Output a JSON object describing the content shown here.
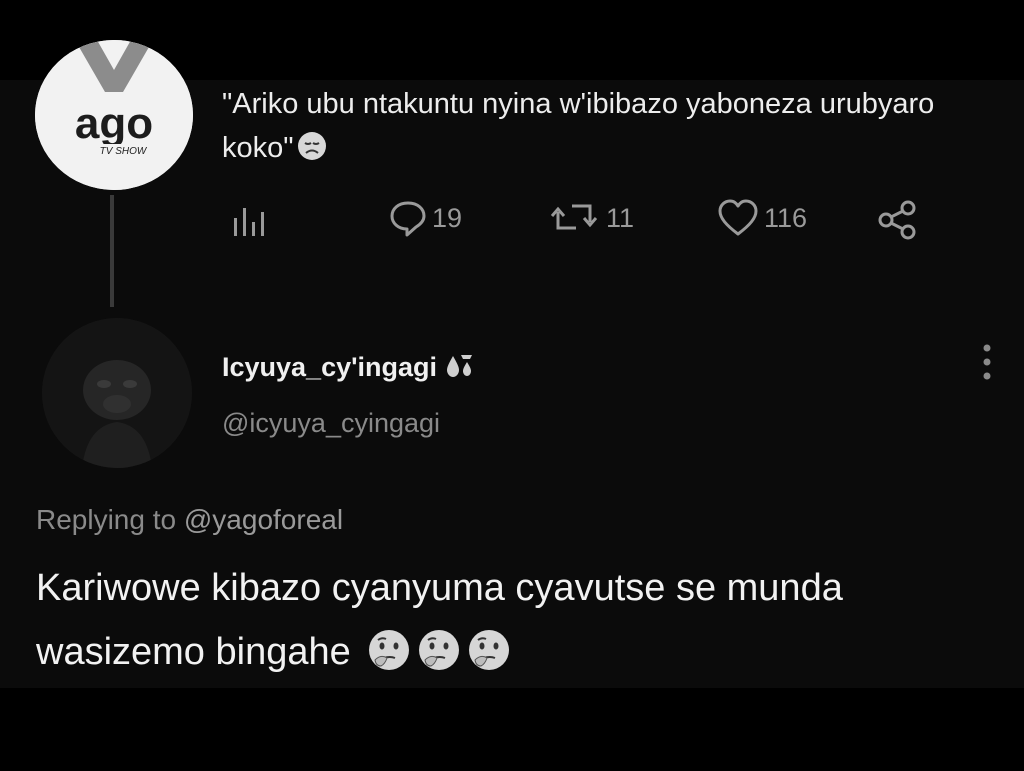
{
  "parent_tweet": {
    "avatar_logo_text": "ago",
    "avatar_logo_sub": "TV SHOW",
    "text": "\"Ariko ubu ntakuntu nyina w'ibibazo yaboneza urubyaro koko\"",
    "emoji": "sad-face-emoji",
    "actions": {
      "analytics_icon": "analytics-icon",
      "replies": "19",
      "retweets": "11",
      "likes": "116",
      "share_icon": "share-icon"
    }
  },
  "reply": {
    "display_name": "Icyuya_cy'ingagi",
    "name_emoji": "sweat-droplets-emoji",
    "handle": "@icyuya_cyingagi",
    "replying_prefix": "Replying to",
    "replying_to": "@yagoforeal",
    "text": "Kariwowe kibazo cyanyuma cyavutse se munda wasizemo bingahe",
    "emojis": [
      "thinking-face-emoji",
      "thinking-face-emoji",
      "thinking-face-emoji"
    ]
  },
  "colors": {
    "background": "#0b0b0b",
    "text_primary": "#ededed",
    "text_secondary": "#8a8a8a",
    "icon": "#9a9a9a"
  }
}
